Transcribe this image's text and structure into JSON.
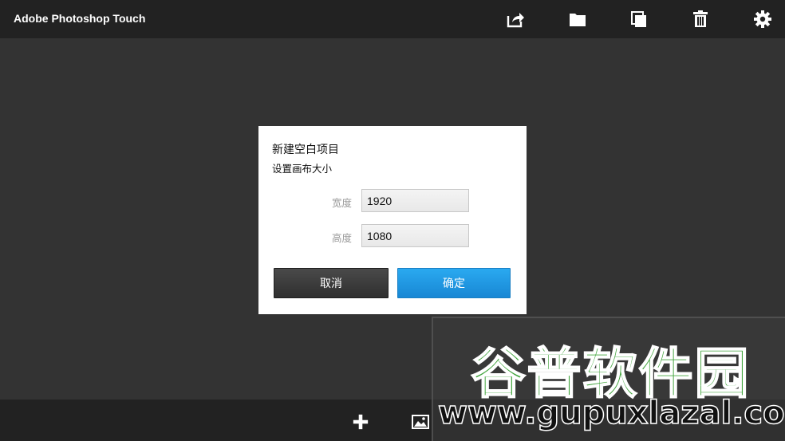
{
  "header": {
    "title": "Adobe Photoshop Touch",
    "actions": [
      {
        "icon": "share-icon"
      },
      {
        "icon": "folder-icon"
      },
      {
        "icon": "duplicate-icon"
      },
      {
        "icon": "trash-icon"
      },
      {
        "icon": "gear-icon"
      }
    ]
  },
  "dialog": {
    "title": "新建空白项目",
    "subtitle": "设置画布大小",
    "width_label": "宽度",
    "width_value": "1920",
    "height_label": "高度",
    "height_value": "1080",
    "cancel_label": "取消",
    "ok_label": "确定",
    "ok_color": "#1e96e2"
  },
  "bottombar": {
    "actions": [
      {
        "icon": "plus-icon"
      },
      {
        "icon": "image-icon"
      }
    ]
  },
  "watermark": {
    "text_cn": "谷普软件园",
    "text_en": "www.gupuxlazal.com"
  }
}
